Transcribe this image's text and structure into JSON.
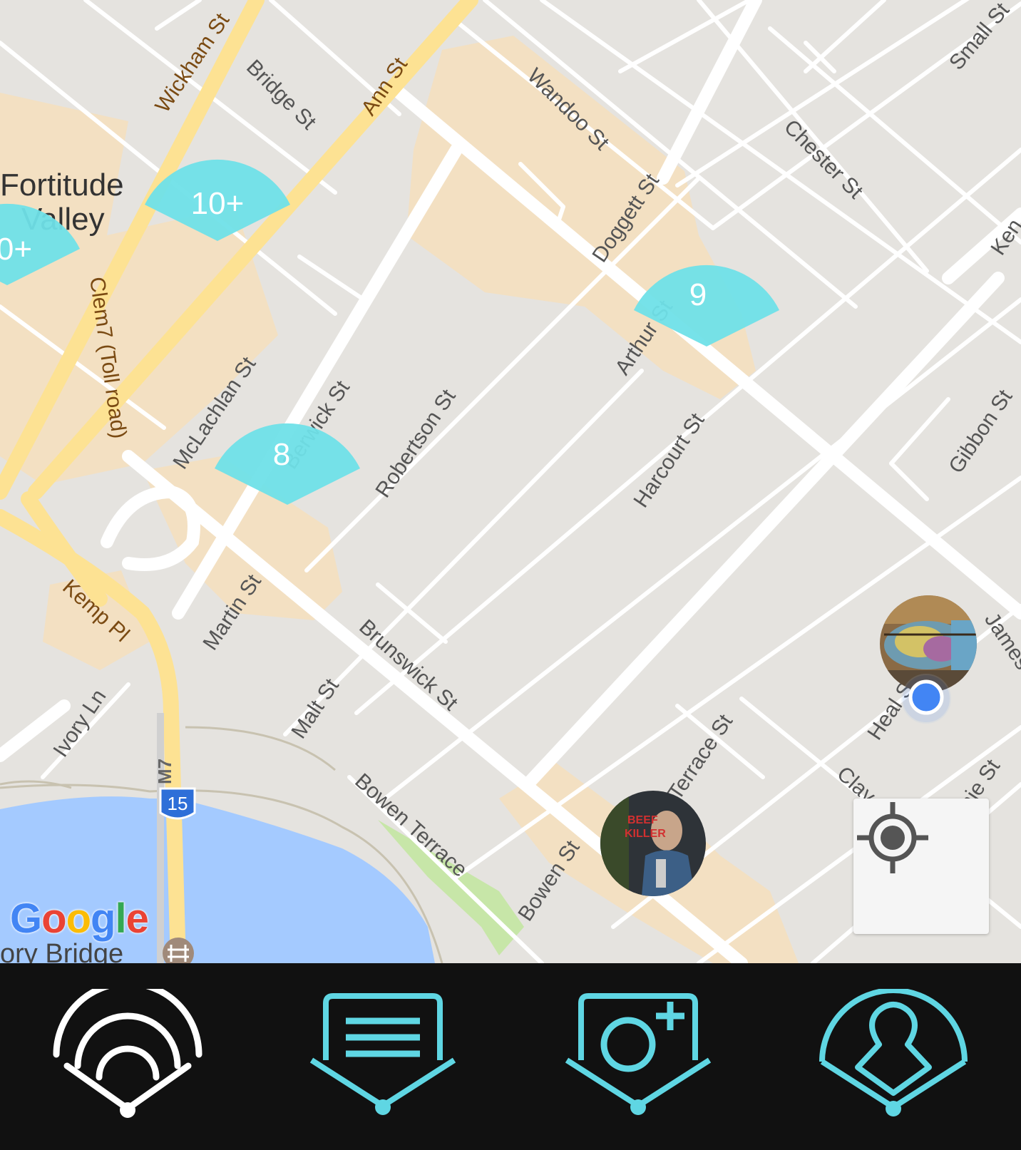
{
  "map": {
    "area_labels": [
      "Fortitude",
      "Valley"
    ],
    "major_roads": [
      "Wickham St",
      "Ann St",
      "Clem7 (Toll road)",
      "Kemp Pl"
    ],
    "streets": [
      "Bridge St",
      "Wandoo St",
      "Chester St",
      "Small St",
      "Doggett St",
      "Arthur St",
      "McLachlan St",
      "Berwick St",
      "Robertson St",
      "Harcourt St",
      "Gibbon St",
      "Martin St",
      "Brunswick St",
      "Malt St",
      "Ivory Ln",
      "Bowen Terrace",
      "Bowen St",
      "Terrace St",
      "Clay St",
      "Annie St",
      "James St",
      "Heal St",
      "Ken"
    ],
    "bottom_place_label": "ory Bridge",
    "highway_shield": "15",
    "motorway_label": "M7",
    "attribution": [
      "G",
      "o",
      "o",
      "g",
      "l",
      "e"
    ],
    "clusters": [
      "10+",
      "0+",
      "9",
      "8"
    ],
    "photo_markers": [
      "mural-photo-marker",
      "beef-killer-photo-marker"
    ],
    "mural_text": [
      "BEEF",
      "KILLER"
    ],
    "colors": {
      "cluster": "#6fe0e8",
      "map_bg": "#e5e3df",
      "road": "#ffffff",
      "major_road": "#fde293",
      "building_area": "#f3e0c2",
      "water": "#a4caff",
      "park": "#c7e6a8",
      "location_dot": "#4285f4",
      "nav_bg": "#111111",
      "nav_accent": "#5fd6e3",
      "nav_active": "#ffffff",
      "google": [
        "#4285F4",
        "#EA4335",
        "#FBBC05",
        "#4285F4",
        "#34A853",
        "#EA4335"
      ]
    }
  },
  "nav": {
    "items": [
      "map-nav-icon",
      "list-nav-icon",
      "add-photo-nav-icon",
      "profile-nav-icon"
    ],
    "active": "map-nav-icon"
  }
}
